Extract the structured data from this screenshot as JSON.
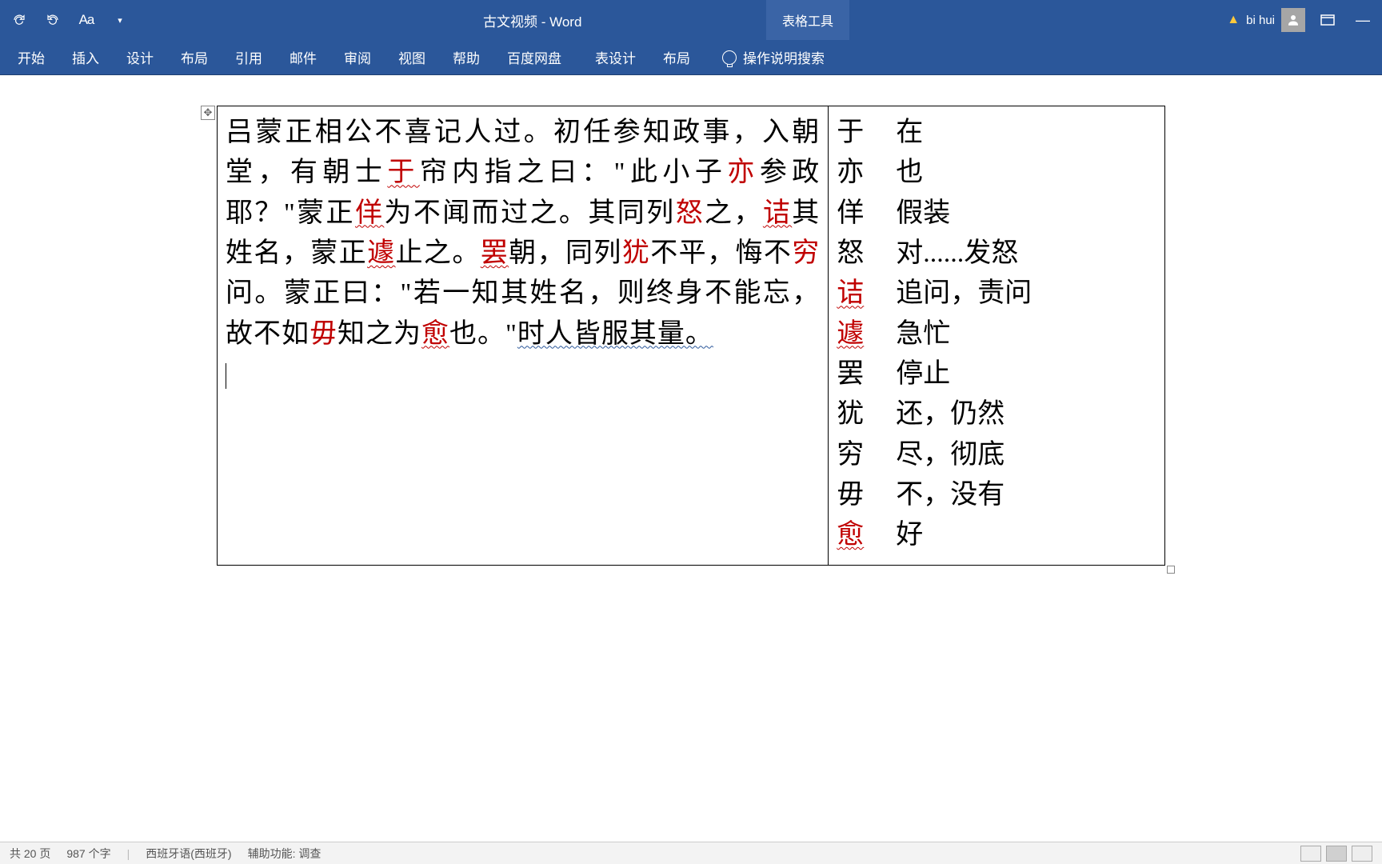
{
  "title": "古文视频 - Word",
  "tool_context": "表格工具",
  "user_name": "bi hui",
  "ribbon": {
    "tabs": [
      "开始",
      "插入",
      "设计",
      "布局",
      "引用",
      "邮件",
      "审阅",
      "视图",
      "帮助",
      "百度网盘"
    ],
    "context_tabs": [
      "表设计",
      "布局"
    ],
    "tellme": "操作说明搜索"
  },
  "qat": {
    "font_label": "Aa"
  },
  "main_text": {
    "s1a": "吕蒙正相公不喜记人过。初任参知政事，入朝堂，有朝士",
    "hl_yu": "于",
    "s1b": "帘内指之曰：\"此小子",
    "hl_yi": "亦",
    "s1c": "参政耶？\"蒙正",
    "hl_yang": "佯",
    "s1d": "为不闻而过之。其同列",
    "hl_nu": "怒",
    "s1e": "之，",
    "hl_jie": "诘",
    "s1f": "其姓名，蒙正",
    "hl_ju": "遽",
    "s1g": "止之。",
    "hl_ba": "罢",
    "s1h": "朝，同列",
    "hl_you": "犹",
    "s1i": "不平，悔不",
    "hl_qiong": "穷",
    "s1j": "问。蒙正曰：\"若一知其姓名，则终身不能忘，故不如",
    "hl_wu": "毋",
    "s1k": "知之为",
    "hl_yu2": "愈",
    "s1l": "也。\"",
    "s1m": "时人皆服其量。"
  },
  "vocab": [
    {
      "term": "于",
      "def": "在"
    },
    {
      "term": "亦",
      "def": "也"
    },
    {
      "term": "佯",
      "def": "假装"
    },
    {
      "term": "怒",
      "def": "对......发怒"
    },
    {
      "term": "诘",
      "def": "追问，责问"
    },
    {
      "term": "遽",
      "def": "急忙"
    },
    {
      "term": "罢",
      "def": "停止"
    },
    {
      "term": "犹",
      "def": "还，仍然"
    },
    {
      "term": "穷",
      "def": "尽，彻底"
    },
    {
      "term": "毋",
      "def": "不，没有"
    },
    {
      "term": "愈",
      "def": "好"
    }
  ],
  "status": {
    "pages": "共 20 页",
    "words": "987 个字",
    "lang": "西班牙语(西班牙)",
    "a11y": "辅助功能: 调查"
  }
}
